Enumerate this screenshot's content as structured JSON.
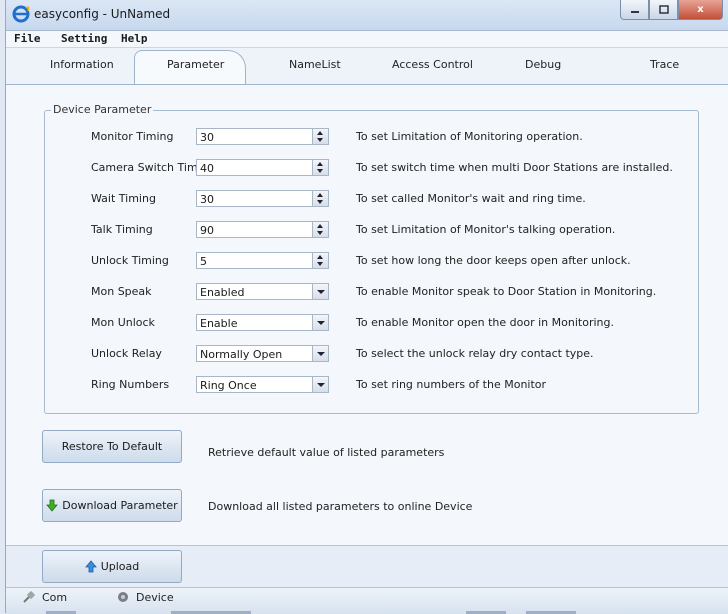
{
  "window": {
    "title": "easyconfig - UnNamed",
    "close_label": "x"
  },
  "menu": [
    "File",
    "Setting",
    "Help"
  ],
  "tabs": [
    "Information",
    "Parameter",
    "NameList",
    "Access Control",
    "Debug",
    "Trace"
  ],
  "active_tab": "Parameter",
  "group_title": "Device Parameter",
  "params": [
    {
      "label": "Monitor Timing",
      "value": "30",
      "control": "spin",
      "desc": "To set Limitation of Monitoring operation."
    },
    {
      "label": "Camera Switch Timing",
      "value": "40",
      "control": "spin",
      "desc": "To set switch time when multi Door Stations are installed."
    },
    {
      "label": "Wait Timing",
      "value": "30",
      "control": "spin",
      "desc": "To set called Monitor's wait and ring time."
    },
    {
      "label": "Talk Timing",
      "value": "90",
      "control": "spin",
      "desc": "To set Limitation of Monitor's talking operation."
    },
    {
      "label": "Unlock Timing",
      "value": "5",
      "control": "spin",
      "desc": "To set how long the door keeps open after unlock."
    },
    {
      "label": "Mon Speak",
      "value": "Enabled",
      "control": "dropdown",
      "desc": "To enable Monitor speak to Door Station in Monitoring."
    },
    {
      "label": "Mon Unlock",
      "value": "Enable",
      "control": "dropdown",
      "desc": "To enable Monitor open the door in Monitoring."
    },
    {
      "label": "Unlock Relay",
      "value": "Normally Open",
      "control": "dropdown",
      "desc": "To select the unlock relay dry contact type."
    },
    {
      "label": "Ring Numbers",
      "value": "Ring Once",
      "control": "dropdown",
      "desc": "To set ring numbers of the Monitor"
    }
  ],
  "restore": {
    "label": "Restore To Default",
    "desc": "Retrieve default value of listed parameters"
  },
  "download": {
    "label": "Download Parameter",
    "desc": "Download all listed parameters to online Device"
  },
  "upload": {
    "label": "Upload"
  },
  "status": {
    "com": "Com",
    "device": "Device"
  }
}
